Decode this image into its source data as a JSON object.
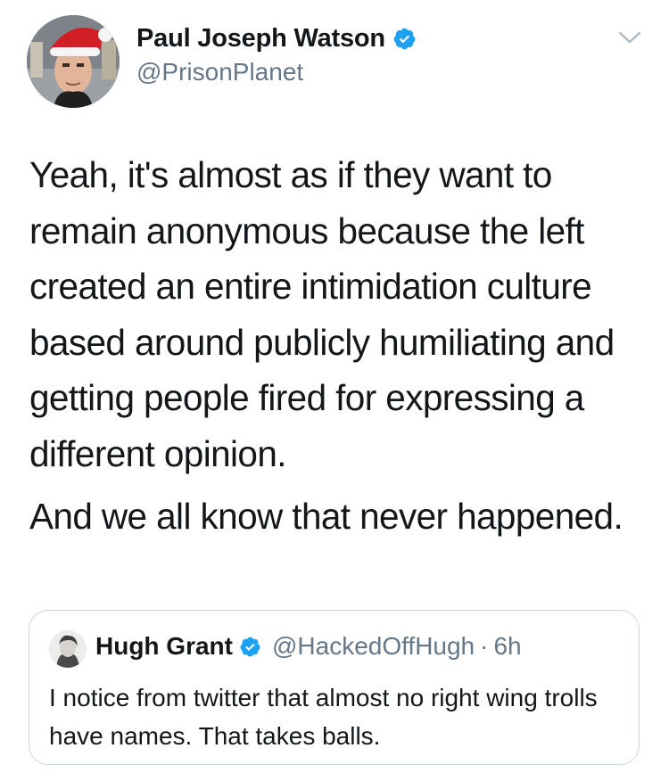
{
  "tweet": {
    "author": {
      "name": "Paul Joseph Watson",
      "handle": "@PrisonPlanet",
      "verified": true,
      "avatar_icon": "profile-photo-santa-hat"
    },
    "menu_icon": "chevron-down-icon",
    "text_paragraph_1": "Yeah, it's almost as if they want to remain anonymous because the left created an entire intimidation culture based around publicly humiliating and getting people fired for expressing a different opinion.",
    "text_paragraph_2": "And we all know that never happened."
  },
  "quoted_tweet": {
    "author": {
      "name": "Hugh Grant",
      "handle": "@HackedOffHugh",
      "verified": true,
      "avatar_icon": "profile-photo"
    },
    "separator": "·",
    "time": "6h",
    "text": "I notice from twitter that almost no right wing trolls have names. That takes balls."
  },
  "colors": {
    "verified_blue": "#1da1f2",
    "text_primary": "#14171a",
    "text_secondary": "#657786",
    "border": "#ccd6dd"
  }
}
